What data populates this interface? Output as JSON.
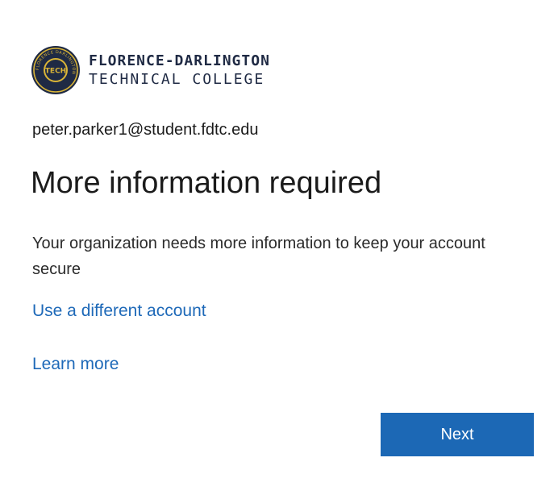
{
  "brand": {
    "seal_text": "TECH",
    "seal_ring_text": "FLORENCE DARLINGTON",
    "name_line1": "FLORENCE-DARLINGTON",
    "name_line2": "TECHNICAL COLLEGE",
    "colors": {
      "navy": "#1f2a44",
      "gold": "#d9b437"
    }
  },
  "account": {
    "email": "peter.parker1@student.fdtc.edu"
  },
  "main": {
    "title": "More information required",
    "description": "Your organization needs more information to keep your account secure",
    "use_different_account_label": "Use a different account",
    "learn_more_label": "Learn more"
  },
  "actions": {
    "next_label": "Next"
  },
  "theme": {
    "link_color": "#1e69b8",
    "button_color": "#1c68b5"
  }
}
